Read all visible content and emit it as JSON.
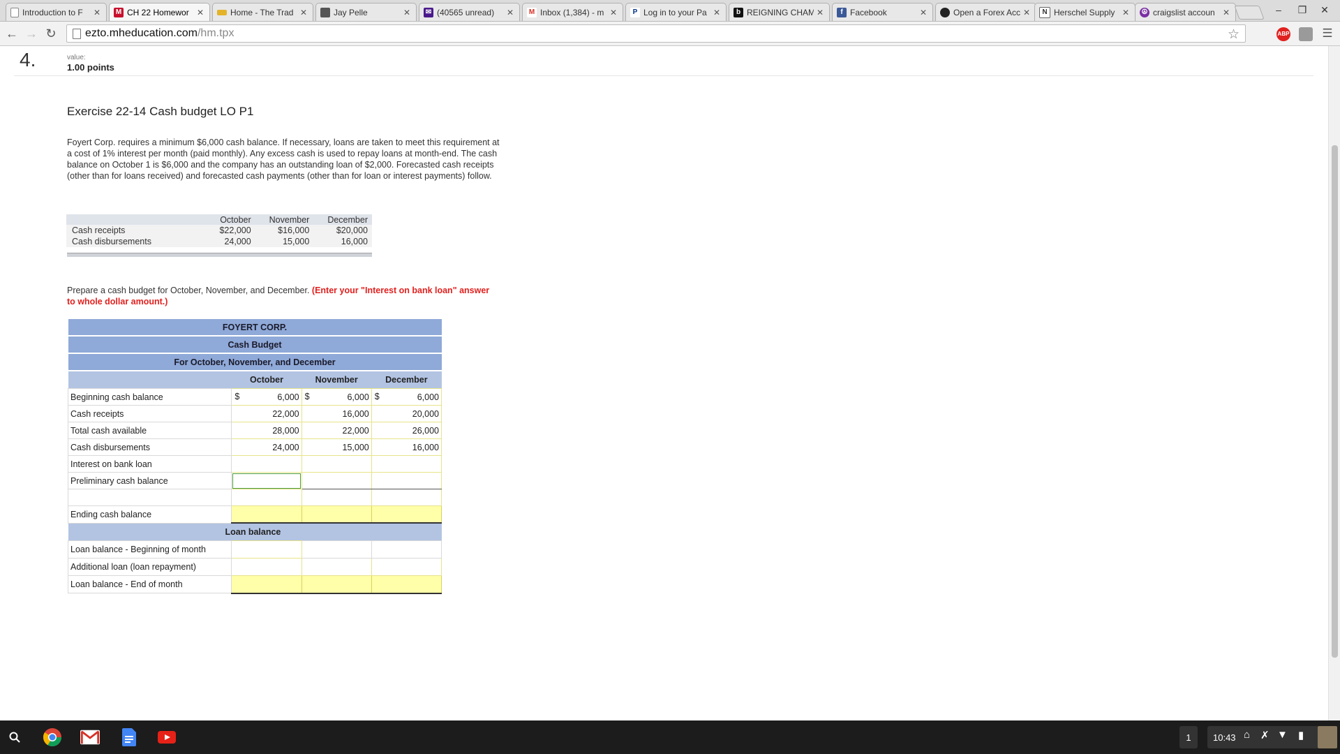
{
  "browser": {
    "tabs": [
      {
        "title": "Introduction to F",
        "favicon": "page-icon",
        "active": false
      },
      {
        "title": "CH 22 Homewor",
        "favicon": "mheducation-m-icon",
        "active": true
      },
      {
        "title": "Home - The Trad",
        "favicon": "car-icon",
        "active": false
      },
      {
        "title": "Jay Pelle",
        "favicon": "cube-icon",
        "active": false
      },
      {
        "title": "(40565 unread)",
        "favicon": "yahoo-mail-icon",
        "active": false
      },
      {
        "title": "Inbox (1,384) - m",
        "favicon": "gmail-icon",
        "active": false
      },
      {
        "title": "Log in to your Pa",
        "favicon": "paypal-icon",
        "active": false
      },
      {
        "title": "REIGNING CHAM",
        "favicon": "b-icon",
        "active": false
      },
      {
        "title": "Facebook",
        "favicon": "facebook-icon",
        "active": false
      },
      {
        "title": "Open a Forex Acc",
        "favicon": "forex-icon",
        "active": false
      },
      {
        "title": "Herschel Supply",
        "favicon": "herschel-icon",
        "active": false
      },
      {
        "title": "craigslist accoun",
        "favicon": "peace-icon",
        "active": false
      }
    ],
    "url_host": "ezto.mheducation.com",
    "url_path": "/hm.tpx",
    "abp_label": "ABP"
  },
  "question": {
    "number": "4.",
    "value_label": "value:",
    "value": "1.00 points",
    "title": "Exercise 22-14 Cash budget LO P1",
    "intro": "Foyert Corp. requires a minimum $6,000 cash balance. If necessary, loans are taken to meet this requirement at a cost of 1% interest per month (paid monthly). Any excess cash is used to repay loans at month-end. The cash balance on October 1 is $6,000 and the company has an outstanding loan of $2,000. Forecasted cash receipts (other than for loans received) and forecasted cash payments (other than for loan or interest payments) follow.",
    "instruction": "Prepare a cash budget for October, November, and December.",
    "instruction_highlight": "(Enter your \"Interest on bank loan\" answer to whole dollar amount.)"
  },
  "forecast_table": {
    "columns": [
      "October",
      "November",
      "December"
    ],
    "rows": [
      {
        "label": "Cash receipts",
        "values": [
          "$22,000",
          "$16,000",
          "$20,000"
        ]
      },
      {
        "label": "Cash disbursements",
        "values": [
          "24,000",
          "15,000",
          "16,000"
        ]
      }
    ]
  },
  "budget": {
    "company": "FOYERT CORP.",
    "title": "Cash Budget",
    "period": "For October, November, and December",
    "columns": [
      "October",
      "November",
      "December"
    ],
    "currency_symbol": "$",
    "rows": [
      {
        "label": "Beginning cash balance",
        "values": [
          "6,000",
          "6,000",
          "6,000"
        ]
      },
      {
        "label": "Cash receipts",
        "values": [
          "22,000",
          "16,000",
          "20,000"
        ]
      },
      {
        "label": "Total cash available",
        "values": [
          "28,000",
          "22,000",
          "26,000"
        ]
      },
      {
        "label": "Cash disbursements",
        "values": [
          "24,000",
          "15,000",
          "16,000"
        ]
      },
      {
        "label": "Interest on bank loan",
        "values": [
          "",
          "",
          ""
        ]
      },
      {
        "label": "Preliminary cash balance",
        "values": [
          "",
          "",
          ""
        ]
      },
      {
        "label": "",
        "values": [
          "",
          "",
          ""
        ]
      },
      {
        "label": "Ending cash balance",
        "values": [
          "",
          "",
          ""
        ]
      }
    ],
    "loan_section_title": "Loan balance",
    "loan_rows": [
      {
        "label": "Loan balance - Beginning of month",
        "values": [
          "",
          "",
          ""
        ]
      },
      {
        "label": "Additional loan (loan repayment)",
        "values": [
          "",
          "",
          ""
        ]
      },
      {
        "label": "Loan balance - End of month",
        "values": [
          "",
          "",
          ""
        ]
      }
    ]
  },
  "shelf": {
    "apps": [
      "search-icon",
      "chrome-icon",
      "gmail-icon",
      "docs-icon",
      "youtube-icon"
    ],
    "workspace": "1",
    "time": "10:43"
  },
  "colors": {
    "header_blue": "#8fa9d8",
    "subheader_blue": "#b3c4e3",
    "input_yellow": "#ffffa9",
    "instruction_red": "#e0211f"
  }
}
